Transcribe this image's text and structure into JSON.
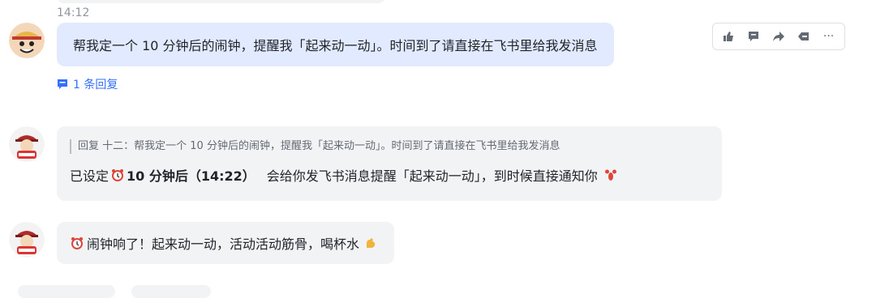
{
  "header": {
    "time": "14:12"
  },
  "messages": [
    {
      "sender": "十二",
      "text": "帮我定一个 10 分钟后的闹钟，提醒我「起来动一动」。时间到了请直接在飞书里给我发消息",
      "thread_label": "1 条回复",
      "toolbar": [
        "thumbs-up-icon",
        "comment-icon",
        "forward-icon",
        "reply-icon",
        "more-icon"
      ],
      "toolbar_more": "···"
    },
    {
      "sender": "bot",
      "quote": "回复 十二：帮我定一个 10 分钟后的闹钟，提醒我「起来动一动」。时间到了请直接在飞书里给我发消息",
      "prefix": "已设定",
      "time_bold": "10 分钟后（14:22）",
      "suffix": "会给你发飞书消息提醒「起来动一动」，到时候直接通知你",
      "emoji_start": "alarm-clock-icon",
      "emoji_end": "lobster-icon"
    },
    {
      "sender": "bot",
      "text": "闹钟响了！起来动一动，活动活动筋骨，喝杯水",
      "emoji_start": "alarm-clock-icon",
      "emoji_end": "flexed-biceps-icon"
    }
  ],
  "colors": {
    "user_bubble": "#e1eaff",
    "bot_bubble": "#f2f3f5",
    "link": "#3370ff",
    "text": "#1f2329",
    "muted": "#8f959e"
  }
}
